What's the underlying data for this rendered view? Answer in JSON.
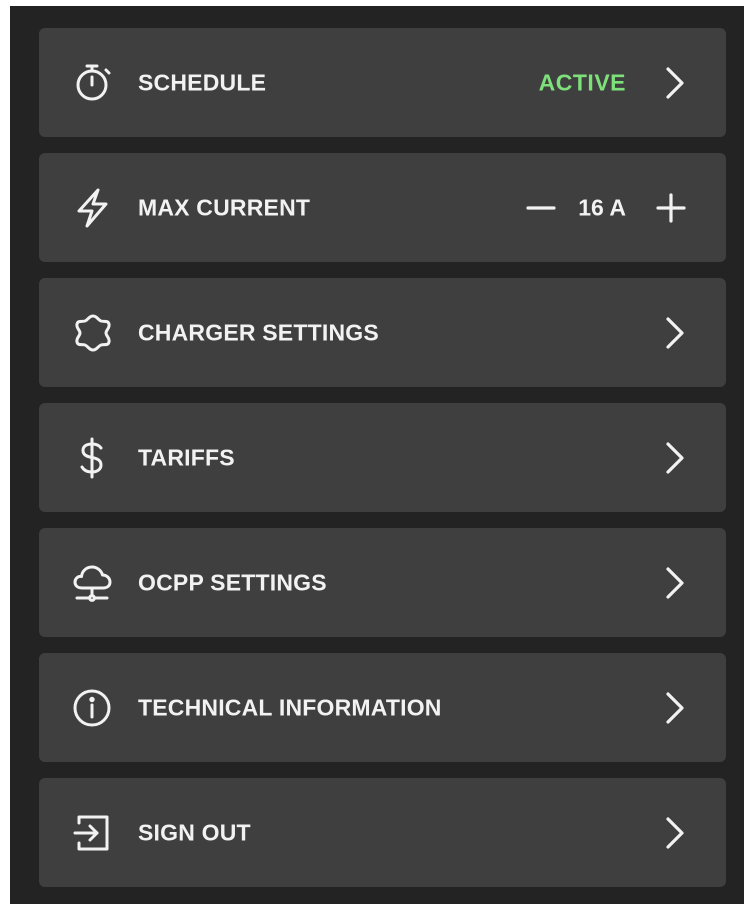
{
  "menu": {
    "schedule": {
      "label": "SCHEDULE",
      "icon": "stopwatch-icon",
      "status": "ACTIVE",
      "status_color": "#7ee07a"
    },
    "max_current": {
      "label": "MAX CURRENT",
      "icon": "lightning-icon",
      "value": "16 A",
      "decrement_icon": "minus-icon",
      "increment_icon": "plus-icon"
    },
    "charger_settings": {
      "label": "CHARGER SETTINGS",
      "icon": "gear-icon"
    },
    "tariffs": {
      "label": "TARIFFS",
      "icon": "dollar-icon"
    },
    "ocpp_settings": {
      "label": "OCPP SETTINGS",
      "icon": "cloud-network-icon"
    },
    "technical_information": {
      "label": "TECHNICAL INFORMATION",
      "icon": "info-icon"
    },
    "sign_out": {
      "label": "SIGN OUT",
      "icon": "sign-out-icon"
    }
  },
  "colors": {
    "background": "#232323",
    "row": "#3f3f3f",
    "text": "#f2f2f2",
    "accent_active": "#7ee07a"
  }
}
